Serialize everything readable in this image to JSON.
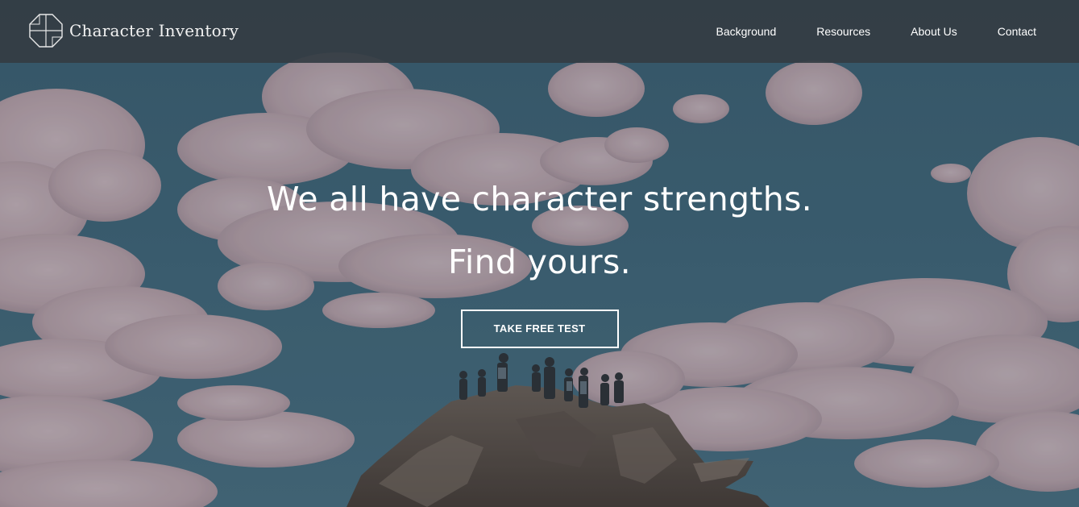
{
  "header": {
    "brand_name": "Character Inventory",
    "logo_icon": "octagon-cross-logo-icon",
    "nav_items": [
      {
        "label": "Background"
      },
      {
        "label": "Resources"
      },
      {
        "label": "About Us"
      },
      {
        "label": "Contact"
      }
    ]
  },
  "hero": {
    "headline_line1": "We all have character strengths.",
    "headline_line2": "Find yours.",
    "cta_label": "TAKE FREE TEST",
    "background_image": "hikers-on-rocky-summit-under-cloudy-sky"
  },
  "colors": {
    "header_bg": "#343c44",
    "sky": "#3e6478",
    "cloud": "#c8aeb4",
    "text": "#ffffff"
  }
}
